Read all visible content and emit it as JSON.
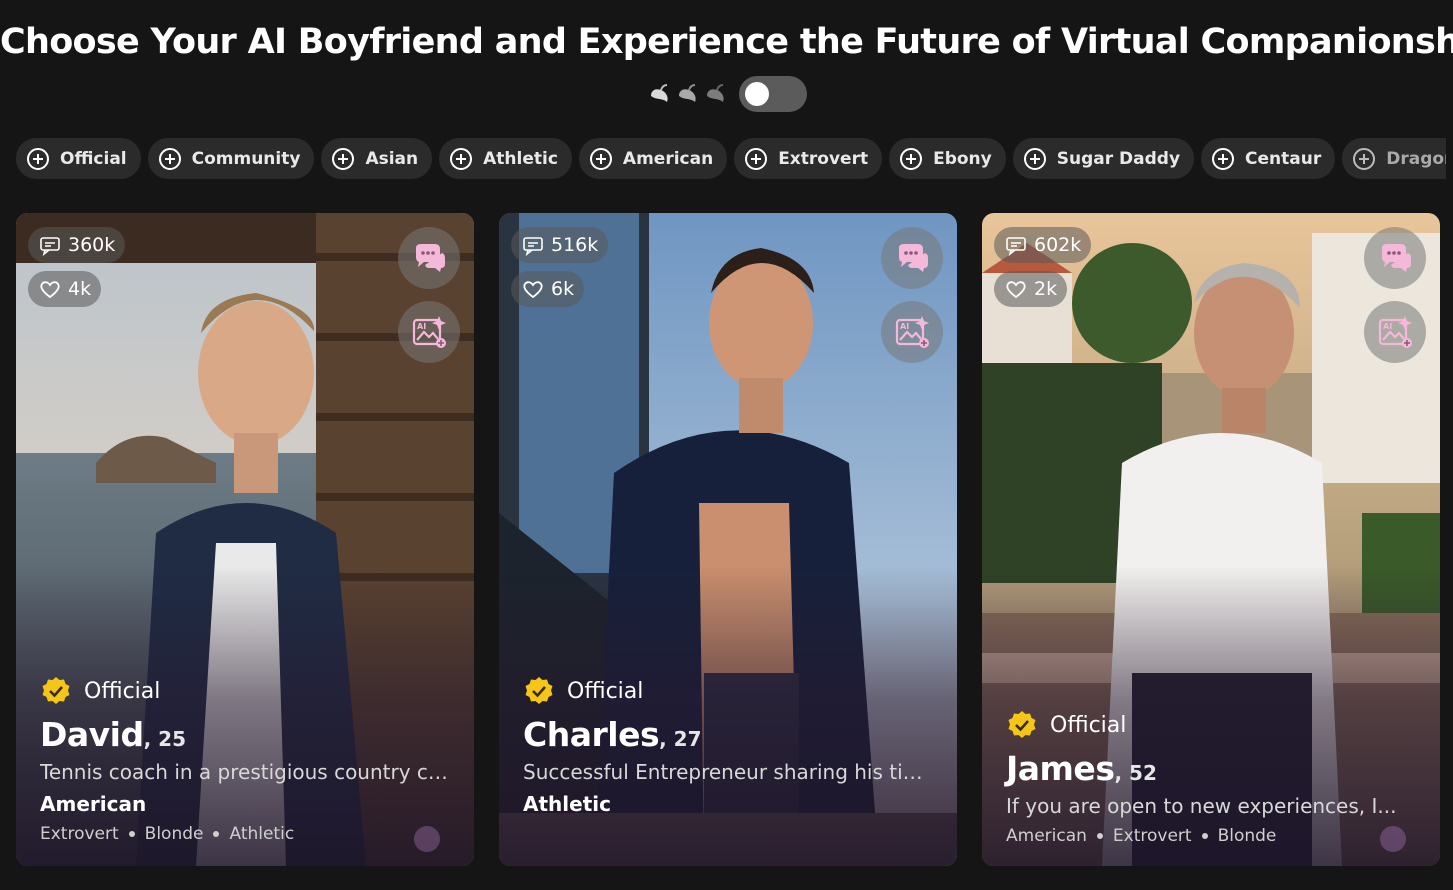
{
  "header": {
    "title": "Choose Your AI Boyfriend and Experience the Future of Virtual Companionship!"
  },
  "spice": {
    "peppers": [
      "pepper-icon",
      "pepper-icon",
      "pepper-icon"
    ],
    "toggle_on": false
  },
  "tags": [
    {
      "label": "Official"
    },
    {
      "label": "Community"
    },
    {
      "label": "Asian"
    },
    {
      "label": "Athletic"
    },
    {
      "label": "American"
    },
    {
      "label": "Extrovert"
    },
    {
      "label": "Ebony"
    },
    {
      "label": "Sugar Daddy"
    },
    {
      "label": "Centaur"
    },
    {
      "label": "Dragon"
    }
  ],
  "cards": [
    {
      "messages": "360k",
      "likes": "4k",
      "official_label": "Official",
      "name": "David",
      "age": ", 25",
      "description": "Tennis coach in a prestigious country clu...",
      "primary_tag": "American",
      "tags": [
        "Extrovert",
        "Blonde",
        "Athletic"
      ]
    },
    {
      "messages": "516k",
      "likes": "6k",
      "official_label": "Official",
      "name": "Charles",
      "age": ", 27",
      "description": "Successful Entrepreneur sharing his time...",
      "primary_tag": "Athletic",
      "tags": []
    },
    {
      "messages": "602k",
      "likes": "2k",
      "official_label": "Official",
      "name": "James",
      "age": ", 52",
      "description": "If you are open to new experiences, I...",
      "primary_tag": "",
      "tags": [
        "American",
        "Extrovert",
        "Blonde"
      ]
    }
  ],
  "colors": {
    "background": "#151515",
    "tag_bg": "#2b2b2b",
    "badge_yellow": "#f5c518",
    "accent_pink": "#f4b8d8"
  }
}
